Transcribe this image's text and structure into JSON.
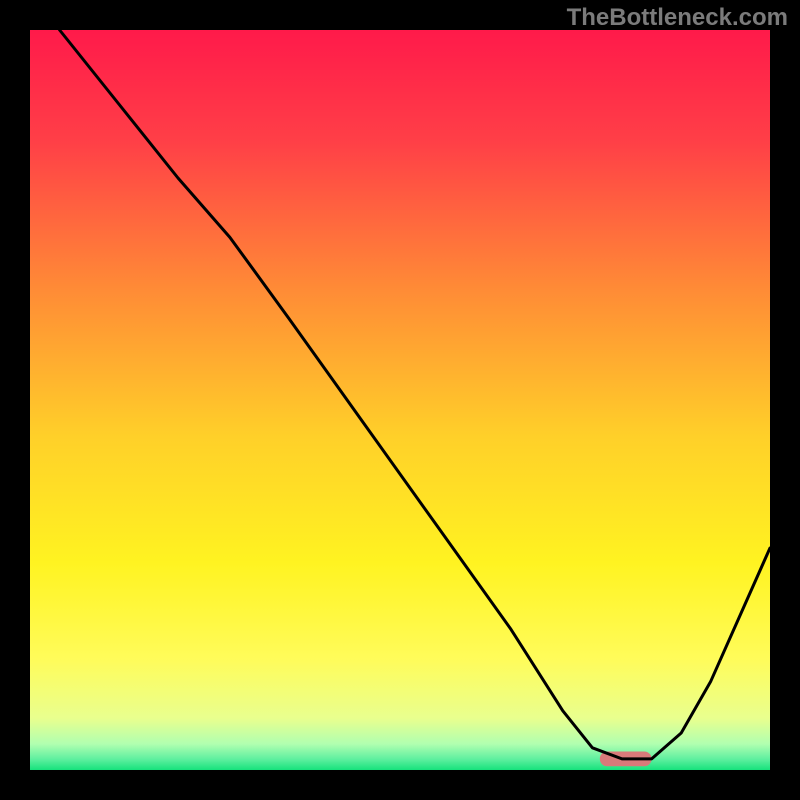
{
  "watermark": "TheBottleneck.com",
  "chart_data": {
    "type": "line",
    "title": "",
    "xlabel": "",
    "ylabel": "",
    "xlim": [
      0,
      100
    ],
    "ylim": [
      0,
      100
    ],
    "grid": false,
    "background_gradient": {
      "stops": [
        {
          "offset": 0.0,
          "color": "#ff1a4a"
        },
        {
          "offset": 0.15,
          "color": "#ff3f47"
        },
        {
          "offset": 0.35,
          "color": "#ff8b36"
        },
        {
          "offset": 0.55,
          "color": "#ffd029"
        },
        {
          "offset": 0.72,
          "color": "#fff321"
        },
        {
          "offset": 0.85,
          "color": "#fffc5a"
        },
        {
          "offset": 0.93,
          "color": "#e9ff8e"
        },
        {
          "offset": 0.965,
          "color": "#b0ffb0"
        },
        {
          "offset": 0.985,
          "color": "#60f0a0"
        },
        {
          "offset": 1.0,
          "color": "#16e27c"
        }
      ]
    },
    "series": [
      {
        "name": "curve",
        "color": "#000000",
        "points": [
          {
            "x": 4.0,
            "y": 100.0
          },
          {
            "x": 12.0,
            "y": 90.0
          },
          {
            "x": 20.0,
            "y": 80.0
          },
          {
            "x": 27.0,
            "y": 72.0
          },
          {
            "x": 35.0,
            "y": 61.0
          },
          {
            "x": 45.0,
            "y": 47.0
          },
          {
            "x": 55.0,
            "y": 33.0
          },
          {
            "x": 65.0,
            "y": 19.0
          },
          {
            "x": 72.0,
            "y": 8.0
          },
          {
            "x": 76.0,
            "y": 3.0
          },
          {
            "x": 80.0,
            "y": 1.5
          },
          {
            "x": 84.0,
            "y": 1.5
          },
          {
            "x": 88.0,
            "y": 5.0
          },
          {
            "x": 92.0,
            "y": 12.0
          },
          {
            "x": 96.0,
            "y": 21.0
          },
          {
            "x": 100.0,
            "y": 30.0
          }
        ]
      }
    ],
    "marker": {
      "color": "#d87a7a",
      "x_start": 77.0,
      "x_end": 84.0,
      "y": 1.5,
      "thickness": 2.0
    },
    "frame": {
      "color": "#000000",
      "width": 30
    }
  }
}
